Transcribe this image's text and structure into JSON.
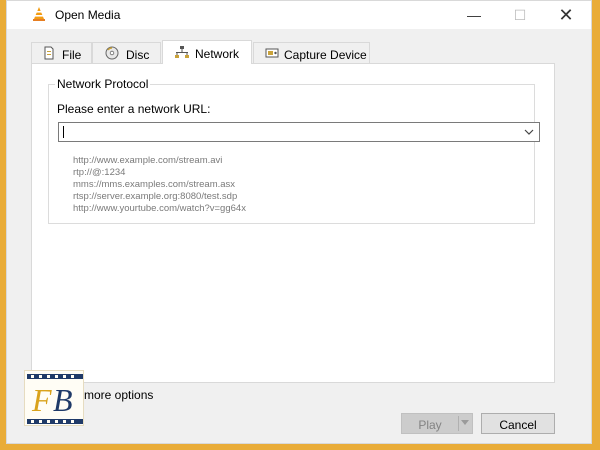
{
  "window": {
    "title": "Open Media",
    "controls": {
      "minimize": "—",
      "maximize": "☐",
      "close": "✕"
    }
  },
  "tabs": [
    {
      "label": "File",
      "icon": "file-icon"
    },
    {
      "label": "Disc",
      "icon": "disc-icon"
    },
    {
      "label": "Network",
      "icon": "network-icon",
      "active": true
    },
    {
      "label": "Capture Device",
      "icon": "capture-device-icon"
    }
  ],
  "network": {
    "group_title": "Network Protocol",
    "url_label": "Please enter a network URL:",
    "url_value": "",
    "examples": [
      "http://www.example.com/stream.avi",
      "rtp://@:1234",
      "mms://mms.examples.com/stream.asx",
      "rtsp://server.example.org:8080/test.sdp",
      "http://www.yourtube.com/watch?v=gg64x"
    ]
  },
  "options": {
    "more_label": "more options",
    "show_more_checked": false
  },
  "buttons": {
    "play": "Play",
    "cancel": "Cancel"
  },
  "logo": {
    "text": "FB"
  },
  "colors": {
    "frame_accent": "#e9ac38",
    "vlc_orange": "#f39c12",
    "logo_blue": "#1f3a68",
    "logo_gold": "#d9a21b"
  }
}
